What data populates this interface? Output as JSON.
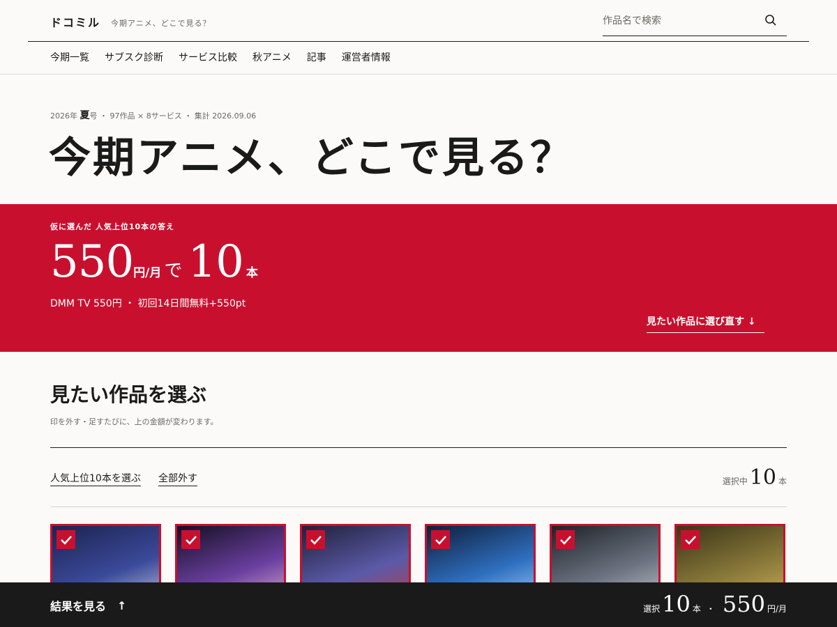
{
  "header": {
    "brand": "ドコミル",
    "tagline": "今期アニメ、どこで見る？",
    "search_placeholder": "作品名で検索",
    "nav": [
      "今期一覧",
      "サブスク診断",
      "サービス比較",
      "秋アニメ",
      "記事",
      "運営者情報"
    ]
  },
  "hero": {
    "meta_year": "2026年",
    "meta_season": "夏",
    "meta_issue": "号",
    "meta_rest": " ・ 97作品 × 8サービス ・ 集計 2026.09.06",
    "title": "今期アニメ、どこで見る？"
  },
  "banner": {
    "kicker": "仮に選んだ 人気上位10本の答え",
    "price": "550",
    "price_unit": "円/月",
    "de": "で",
    "count": "10",
    "count_unit": "本",
    "sub": "DMM TV 550円 ・ 初回14日間無料+550pt",
    "reselect": "見たい作品に選び直す ↓"
  },
  "selection": {
    "title": "見たい作品を選ぶ",
    "desc": "印を外す・足すたびに、上の金額が変わります。",
    "select_top": "人気上位10本を選ぶ",
    "clear_all": "全部外す",
    "counter_label": "選択中",
    "counter_value": "10",
    "counter_unit": "本"
  },
  "cards": [
    {
      "colors": [
        "#1b2350",
        "#3b4a9a",
        "#c9cfe0"
      ],
      "checked": true
    },
    {
      "colors": [
        "#150f22",
        "#6a3fa0",
        "#e8b7d0"
      ],
      "checked": true
    },
    {
      "colors": [
        "#20203a",
        "#5b5aa8",
        "#c23a3a"
      ],
      "checked": true
    },
    {
      "colors": [
        "#0f1e3a",
        "#2f6fc0",
        "#a9d8ff"
      ],
      "checked": true
    },
    {
      "colors": [
        "#1e2228",
        "#6c7380",
        "#c7ccd3"
      ],
      "checked": true
    },
    {
      "colors": [
        "#3b3418",
        "#8a7a3a",
        "#d9b35a"
      ],
      "checked": true
    }
  ],
  "bottombar": {
    "result": "結果を見る",
    "arrow": "↑",
    "select_label": "選択",
    "count": "10",
    "count_unit": "本",
    "sep": "・",
    "price": "550",
    "price_unit": "円/月"
  },
  "colors": {
    "accent": "#c8102e",
    "ink": "#1a1a1a",
    "background": "#fbfaf8",
    "bottombar": "#1a1a1a"
  }
}
